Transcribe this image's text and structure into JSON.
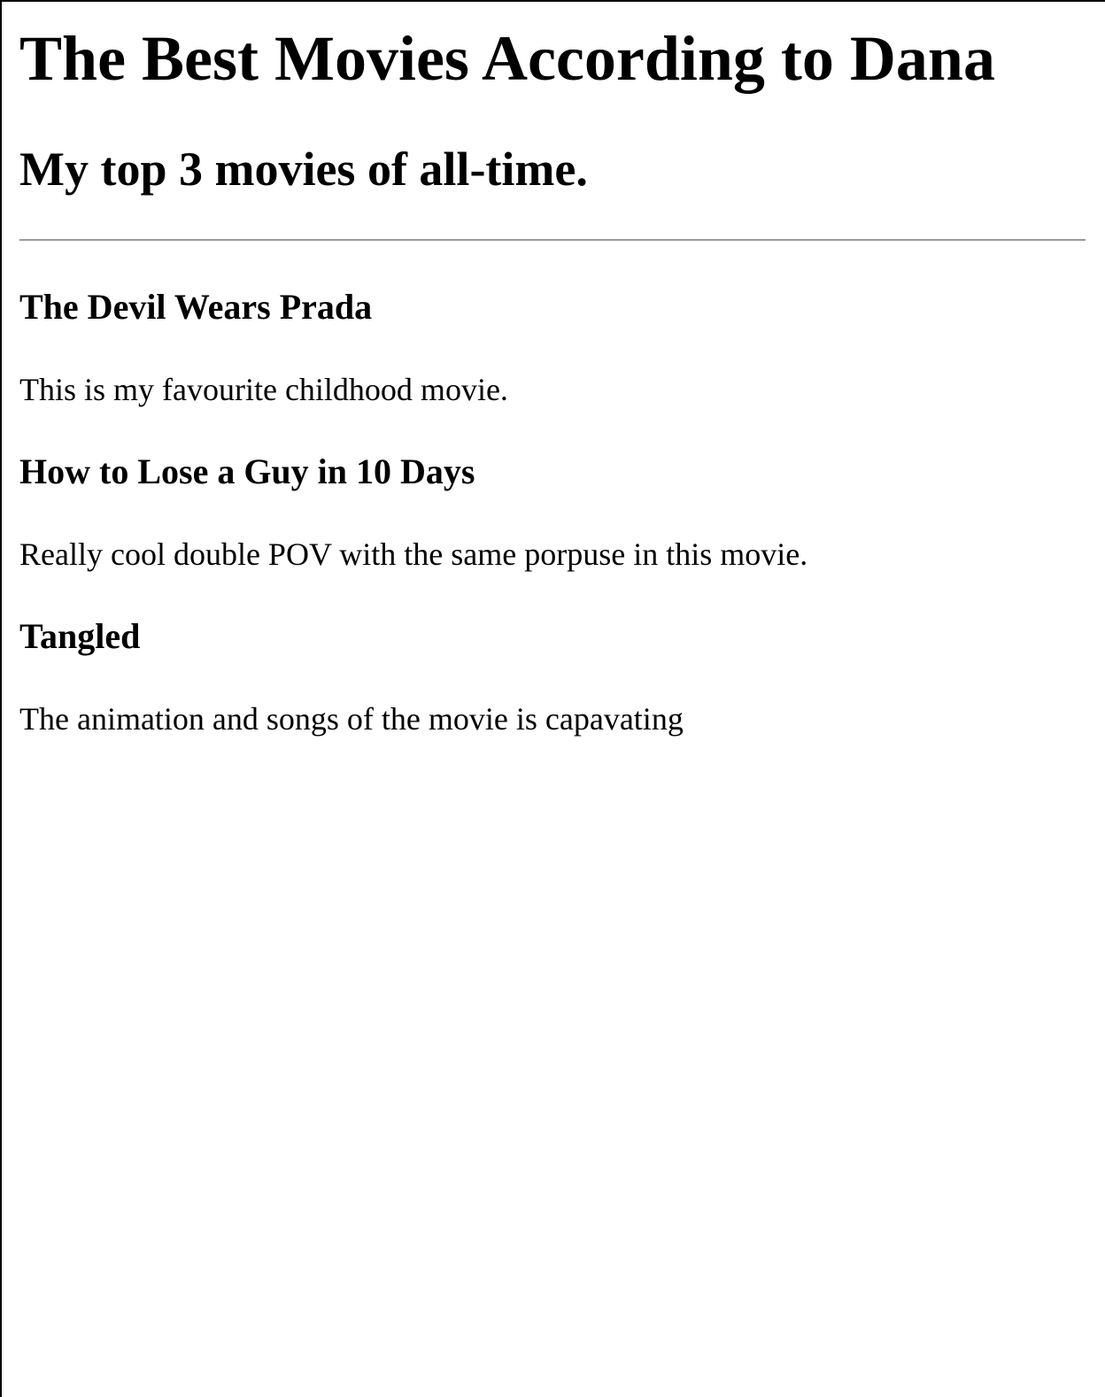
{
  "page": {
    "title": "The Best Movies According to Dana",
    "subtitle": "My top 3 movies of all-time."
  },
  "movies": [
    {
      "title": "The Devil Wears Prada",
      "description": "This is my favourite childhood movie."
    },
    {
      "title": "How to Lose a Guy in 10 Days",
      "description": "Really cool double POV with the same porpuse in this movie."
    },
    {
      "title": "Tangled",
      "description": "The animation and songs of the movie is capavating"
    }
  ]
}
